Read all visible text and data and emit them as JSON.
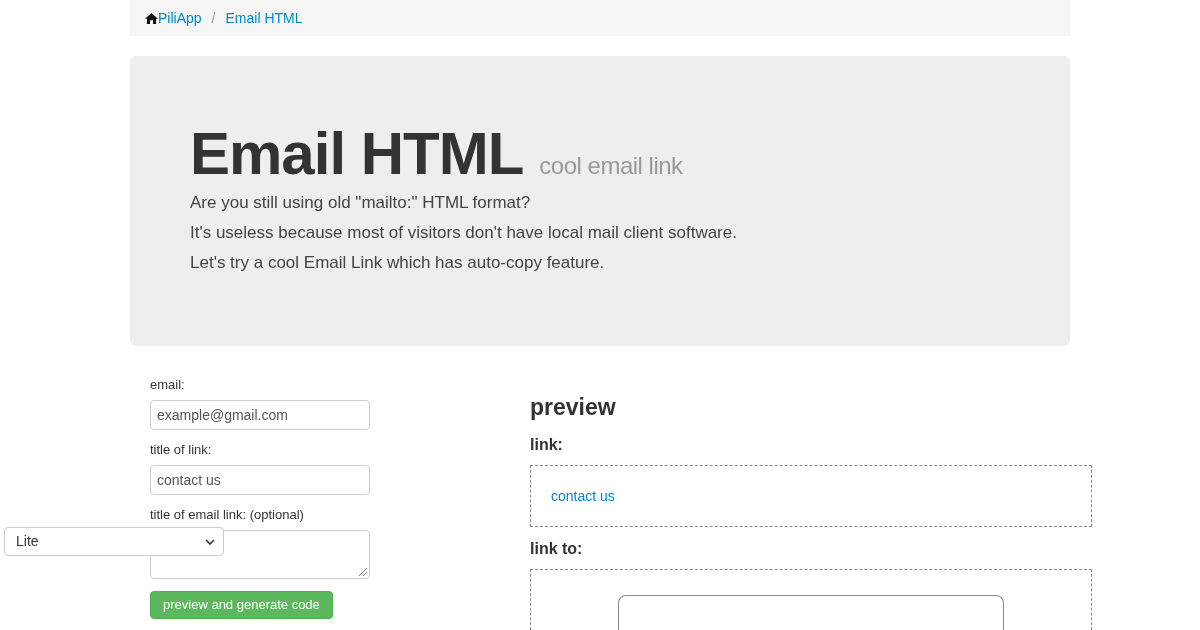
{
  "breadcrumb": {
    "items": [
      {
        "label": "PiliApp",
        "kind": "home"
      },
      {
        "label": "Email HTML",
        "kind": "link"
      }
    ],
    "separator": "/"
  },
  "hero": {
    "title": "Email HTML",
    "subtitle": "cool email link",
    "lines": [
      "Are you still using old \"mailto:\" HTML format?",
      "It's useless because most of visitors don't have local mail client software.",
      "Let's try a cool Email Link which has auto-copy feature."
    ]
  },
  "form": {
    "fields": [
      {
        "label": "email:",
        "kind": "input",
        "value": "example@gmail.com"
      },
      {
        "label": "title of link:",
        "kind": "input",
        "value": "contact us"
      },
      {
        "label": "title of email link: (optional)",
        "kind": "textarea"
      }
    ],
    "button": "preview and generate code"
  },
  "theme_select": {
    "value": "Lite"
  },
  "preview": {
    "title": "preview",
    "link_heading": "link:",
    "link_text": "contact us",
    "link_to_heading": "link to:"
  }
}
